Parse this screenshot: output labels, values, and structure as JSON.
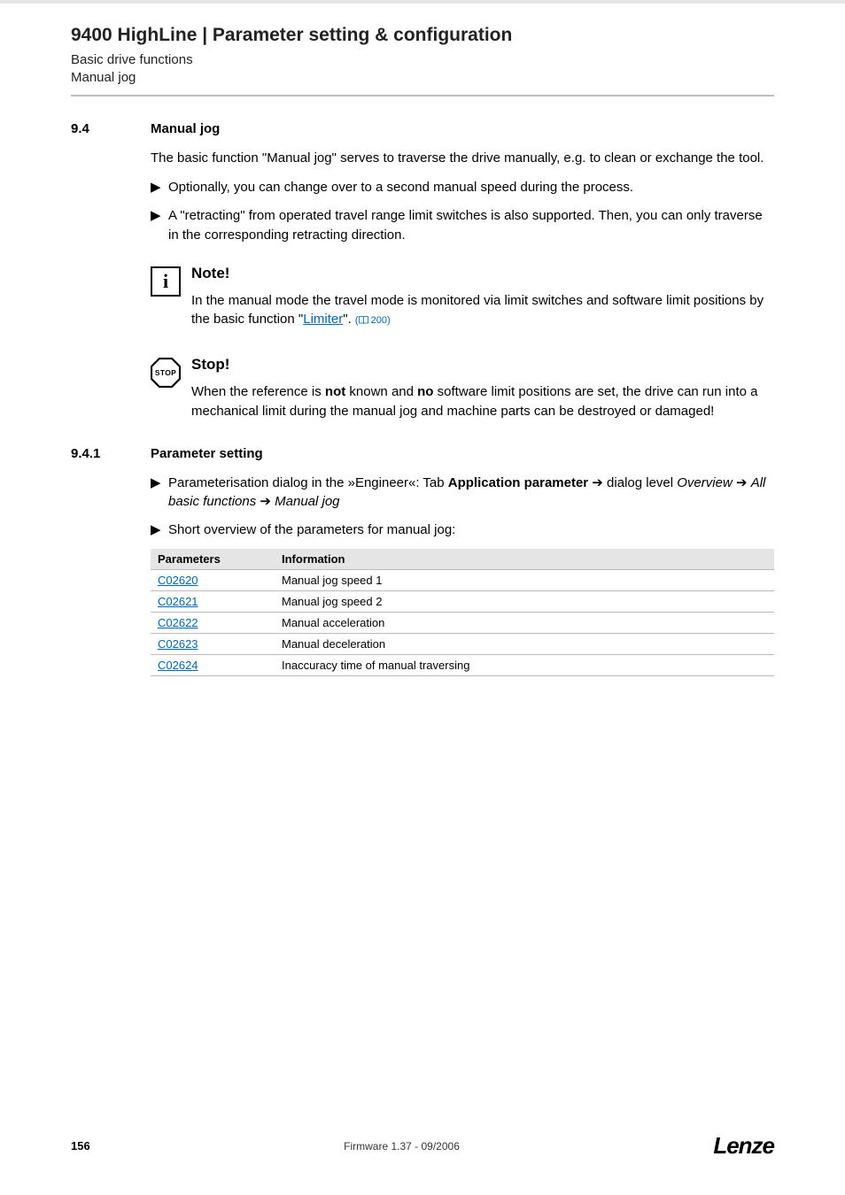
{
  "header": {
    "title": "9400 HighLine | Parameter setting & configuration",
    "sub1": "Basic drive functions",
    "sub2": "Manual jog"
  },
  "sec94": {
    "num": "9.4",
    "title": "Manual jog",
    "para": "The basic function \"Manual jog\" serves to traverse the drive manually, e.g. to clean or exchange the tool.",
    "b1": "Optionally, you can change over to a second manual speed during the process.",
    "b2": "A \"retracting\" from operated travel range limit switches is also supported. Then, you can only traverse in the corresponding retracting direction."
  },
  "note": {
    "title": "Note!",
    "pre": "In the manual mode the travel mode is monitored via limit switches and software limit positions by the basic function \"",
    "link": "Limiter",
    "post": "\".",
    "ref": "200"
  },
  "stop": {
    "title": "Stop!",
    "pre": "When the reference is ",
    "b1": "not",
    "mid1": " known and ",
    "b2": "no",
    "post": " software limit positions are set, the drive can run into a mechanical limit during the manual jog and machine parts can be destroyed or damaged!"
  },
  "sec941": {
    "num": "9.4.1",
    "title": "Parameter setting",
    "b1_pre": "Parameterisation dialog in the »Engineer«: Tab ",
    "b1_bold": "Application parameter",
    "b1_arrow1": " ➔ ",
    "b1_mid": "dialog level ",
    "b1_i1": "Overview",
    "b1_i2": "All basic functions",
    "b1_i3": "Manual jog",
    "b2": "Short overview of the parameters for manual jog:"
  },
  "table": {
    "h1": "Parameters",
    "h2": "Information",
    "rows": [
      {
        "p": "C02620",
        "i": "Manual jog speed 1"
      },
      {
        "p": "C02621",
        "i": "Manual jog speed 2"
      },
      {
        "p": "C02622",
        "i": "Manual acceleration"
      },
      {
        "p": "C02623",
        "i": "Manual deceleration"
      },
      {
        "p": "C02624",
        "i": "Inaccuracy time of manual traversing"
      }
    ]
  },
  "footer": {
    "page": "156",
    "fw": "Firmware 1.37 - 09/2006",
    "logo": "Lenze"
  }
}
